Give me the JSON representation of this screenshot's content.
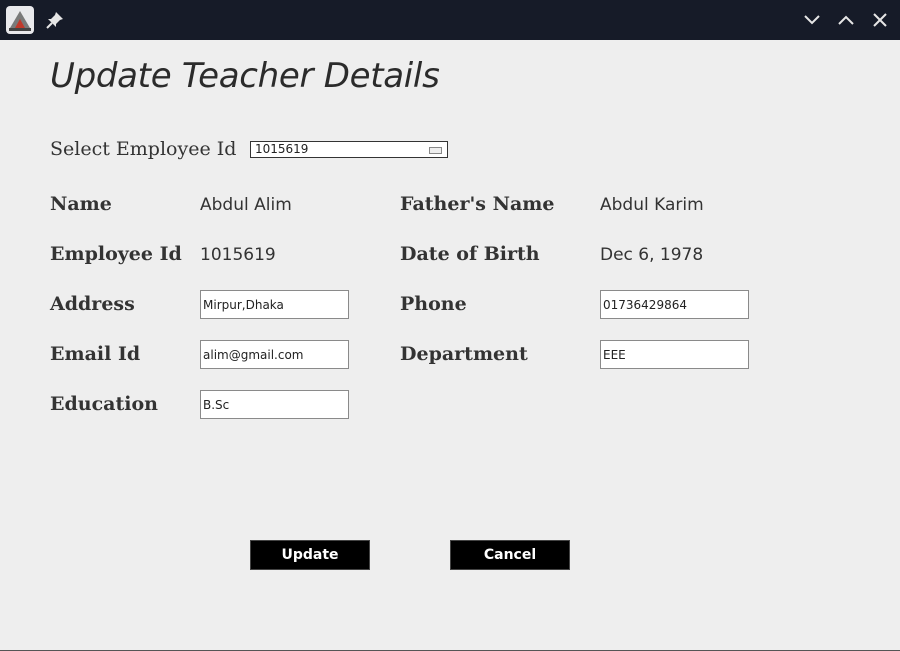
{
  "form": {
    "title": "Update Teacher Details",
    "select_label": "Select Employee Id",
    "selected_employee_id": "1015619"
  },
  "labels": {
    "name": "Name",
    "fathers_name": "Father's Name",
    "employee_id": "Employee Id",
    "dob": "Date of Birth",
    "address": "Address",
    "phone": "Phone",
    "email": "Email Id",
    "department": "Department",
    "education": "Education"
  },
  "values": {
    "name": "Abdul Alim",
    "fathers_name": "Abdul Karim",
    "employee_id": "1015619",
    "dob": "Dec 6, 1978"
  },
  "fields": {
    "address": "Mirpur,Dhaka",
    "phone": "01736429864",
    "email": "alim@gmail.com",
    "department": "EEE",
    "education": "B.Sc"
  },
  "buttons": {
    "update": "Update",
    "cancel": "Cancel"
  },
  "colors": {
    "titlebar": "#161b28",
    "background": "#eeeeee",
    "button": "#000000"
  }
}
